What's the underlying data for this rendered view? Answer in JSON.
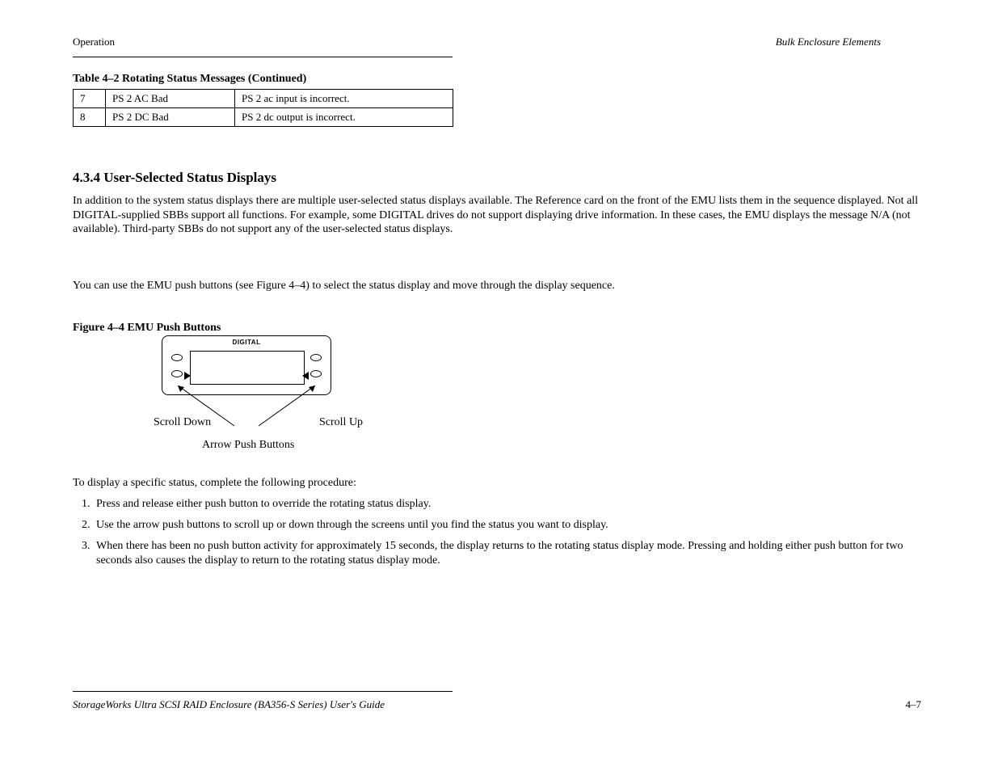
{
  "header": {
    "left": "Operation",
    "right": "Bulk Enclosure Elements"
  },
  "footer": {
    "left": "StorageWorks Ultra SCSI RAID Enclosure (BA356-S Series) User's Guide",
    "right": "4–7"
  },
  "table": {
    "title": "Table 4–2  Rotating Status Messages  (Continued)",
    "rows": [
      {
        "no": "7",
        "msg": "PS 2 AC Bad",
        "desc": "PS 2 ac input is incorrect."
      },
      {
        "no": "8",
        "msg": "PS 2 DC Bad",
        "desc": "PS 2 dc output is incorrect."
      }
    ]
  },
  "section": {
    "heading": "4.3.4    User-Selected Status Displays",
    "p1": "In addition to the system status displays there are multiple user-selected status displays available. The Reference card on the front of the EMU lists them in the sequence displayed. Not all DIGITAL-supplied SBBs support all functions. For example, some DIGITAL drives do not support displaying drive information. In these cases, the EMU displays the message N/A (not available). Third-party SBBs do not support any of the user-selected status displays.",
    "p2": "You can use the EMU push buttons (see Figure 4–4) to select the status display and move through the display sequence."
  },
  "figure": {
    "caption": "Figure 4–4  EMU Push Buttons",
    "brand": "DIGITAL",
    "label_down": "Scroll Down",
    "label_up": "Scroll Up",
    "label_buttons": "Arrow Push Buttons"
  },
  "steps": {
    "intro": "To display a specific status, complete the following procedure:",
    "items": [
      "Press and release either push button to override the rotating status display.",
      "Use the arrow push buttons to scroll up or down through the screens until you find the status you want to display.",
      "When there has been no push button activity for approximately 15 seconds, the display returns to the rotating status display mode. Pressing and holding either push button for two seconds also causes the display to return to the rotating status display mode."
    ]
  }
}
